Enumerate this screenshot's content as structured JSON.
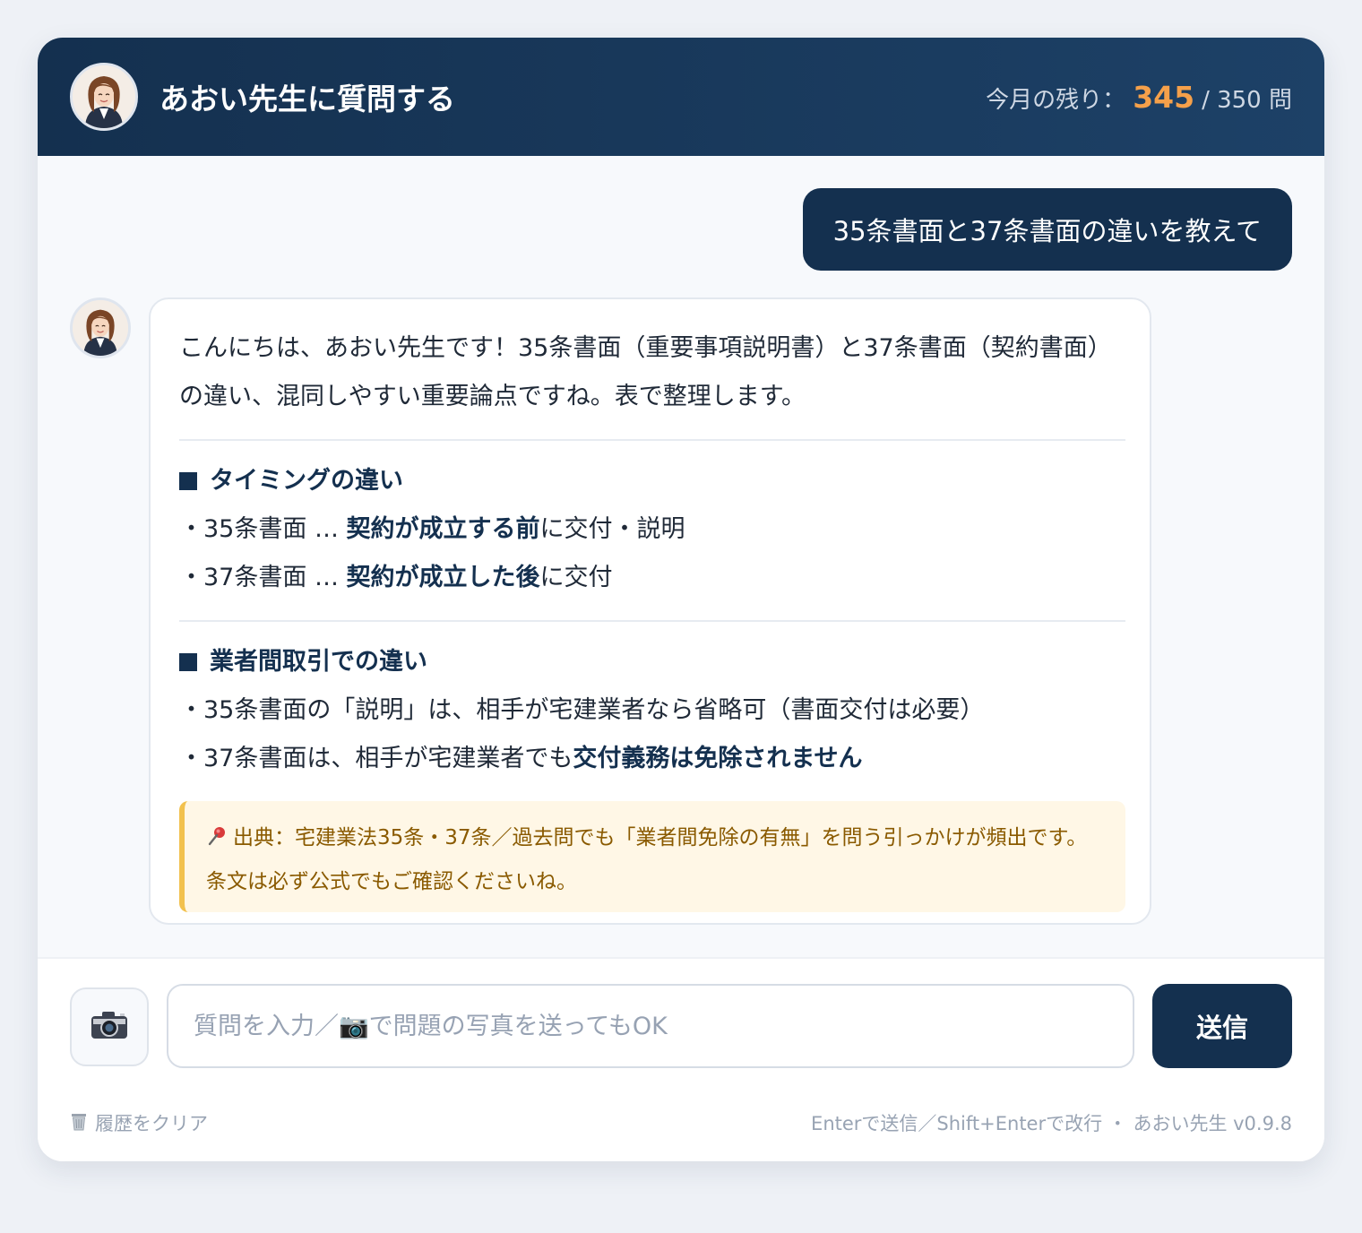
{
  "header": {
    "title": "あおい先生に質問する",
    "quota_prefix": "今月の残り：",
    "quota_remaining": "345",
    "quota_total": "/ 350 問"
  },
  "messages": {
    "user": "35条書面と37条書面の違いを教えて",
    "bot": {
      "intro": "こんにちは、あおい先生です！35条書面（重要事項説明書）と37条書面（契約書面）の違い、混同しやすい重要論点ですね。表で整理します。",
      "section1_title": "タイミングの違い",
      "s1_line1_pre": "・35条書面 … ",
      "s1_line1_bold": "契約が成立する前",
      "s1_line1_post": "に交付・説明",
      "s1_line2_pre": "・37条書面 … ",
      "s1_line2_bold": "契約が成立した後",
      "s1_line2_post": "に交付",
      "section2_title": "業者間取引での違い",
      "s2_line1": "・35条書面の「説明」は、相手が宅建業者なら省略可（書面交付は必要）",
      "s2_line2_pre": "・37条書面は、相手が宅建業者でも",
      "s2_line2_bold": "交付義務は免除されません",
      "source": "出典：宅建業法35条・37条／過去問でも「業者間免除の有無」を問う引っかけが頻出です。条文は必ず公式でもご確認くださいね。"
    }
  },
  "input": {
    "placeholder": "質問を入力／📷で問題の写真を送ってもOK",
    "value": "",
    "send_label": "送信"
  },
  "footer": {
    "clear_label": "履歴をクリア",
    "hint": "Enterで送信／Shift+Enterで改行 ・ あおい先生 v0.9.8"
  },
  "colors": {
    "header_bg": "#14304f",
    "accent": "#f5a04a",
    "source_bg": "#fff7e6",
    "source_border": "#f2c14e"
  },
  "icons": {
    "avatar": "teacher-avatar",
    "camera": "camera-icon",
    "pin": "pushpin-icon",
    "trash": "trash-icon"
  }
}
